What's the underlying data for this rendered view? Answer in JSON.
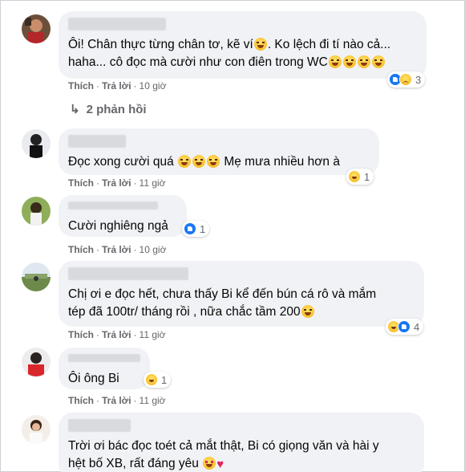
{
  "actions": {
    "like_label": "Thích",
    "reply_label": "Trả lời",
    "separator": "·"
  },
  "comments": [
    {
      "lines": [
        "Ôi! Chân thực từng chân tơ, kẽ ví",
        ". Ko lệch đi tí nào cả...",
        "haha... cô đọc mà cười như con điên trong WC"
      ],
      "reactions": {
        "icons": [
          "like-icon",
          "sad-icon"
        ],
        "count": "3"
      },
      "time": "10 giờ",
      "replies": "2 phản hồi"
    },
    {
      "lines": [
        "Đọc xong cười quá",
        "Mẹ mưa nhiều hơn à"
      ],
      "reactions": {
        "icons": [
          "haha-icon"
        ],
        "count": "1"
      },
      "time": "11 giờ"
    },
    {
      "lines": [
        "Cười nghiêng ngả"
      ],
      "reactions": {
        "icons": [
          "like-icon"
        ],
        "count": "1"
      },
      "time": "10 giờ"
    },
    {
      "lines": [
        "Chị ơi e đọc hết, chưa thấy Bi kể đến bún cá rô và mắm",
        "tép đã 100tr/ tháng rồi , nữa chắc tầm 200"
      ],
      "reactions": {
        "icons": [
          "haha-icon",
          "like-icon"
        ],
        "count": "4"
      },
      "time": "11 giờ"
    },
    {
      "lines": [
        "Ôi ông Bi"
      ],
      "reactions": {
        "icons": [
          "haha-icon"
        ],
        "count": "1"
      },
      "time": "11 giờ"
    },
    {
      "lines": [
        "Trời ơi bác đọc toét cả mắt thật, Bi có giọng văn và hài y",
        "hệt bố XB, rất đáng yêu"
      ],
      "time": ""
    }
  ],
  "colors": {
    "bubble": "#f0f2f5",
    "secondary_text": "#65676b",
    "like_blue": "#1877f2",
    "heart": "#e0245e"
  }
}
